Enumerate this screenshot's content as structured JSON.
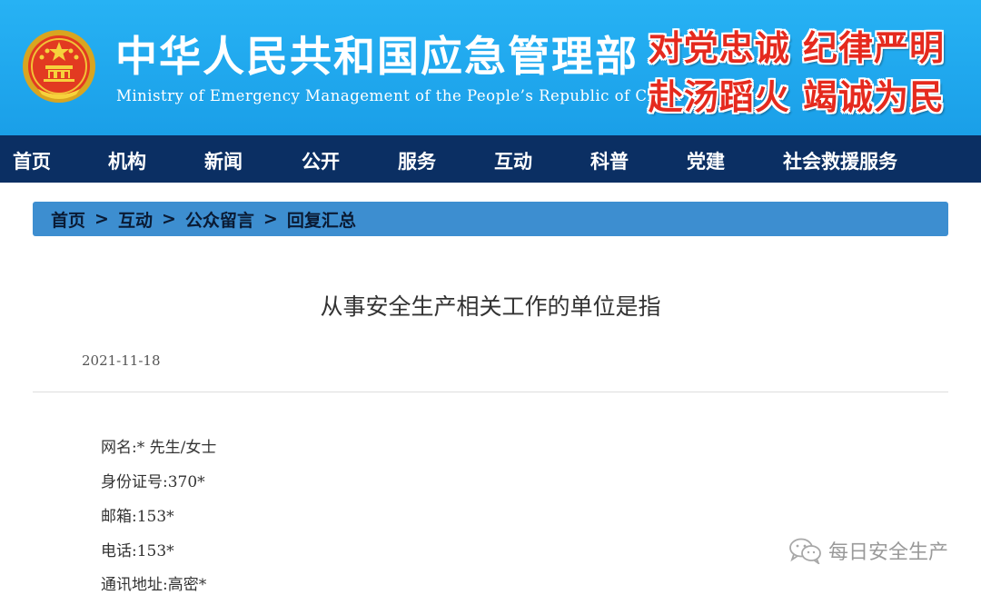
{
  "header": {
    "title": "中华人民共和国应急管理部",
    "subtitle": "Ministry of Emergency Management of the People’s Republic of China",
    "slogan_line1": "对党忠诚 纪律严明",
    "slogan_line2": "赴汤蹈火 竭诚为民",
    "emblem_icon": "national-emblem-icon",
    "colors": {
      "header_bg": "#1fa8f0",
      "nav_bg": "#0b2f63",
      "slogan": "#e52a1e",
      "breadcrumb_bg": "#3d8ed0"
    }
  },
  "nav": {
    "items": [
      {
        "label": "首页"
      },
      {
        "label": "机构"
      },
      {
        "label": "新闻"
      },
      {
        "label": "公开"
      },
      {
        "label": "服务"
      },
      {
        "label": "互动"
      },
      {
        "label": "科普"
      },
      {
        "label": "党建"
      },
      {
        "label": "社会救援服务"
      }
    ]
  },
  "breadcrumb": {
    "items": [
      "首页",
      "互动",
      "公众留言",
      "回复汇总"
    ],
    "separator": ">"
  },
  "article": {
    "title": "从事安全生产相关工作的单位是指",
    "date": "2021-11-18",
    "fields": [
      "网名:* 先生/女士",
      "身份证号:370*",
      "邮箱:153*",
      "电话:153*",
      "通讯地址:高密*"
    ]
  },
  "watermark": {
    "text": "每日安全生产",
    "icon": "wechat-icon"
  }
}
